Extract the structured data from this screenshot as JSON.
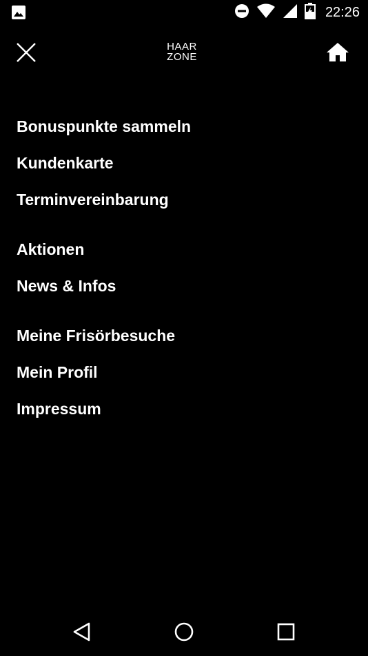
{
  "status_bar": {
    "time": "22:26",
    "icons": [
      "image-notification-icon",
      "do-not-disturb-icon",
      "wifi-icon",
      "cellular-signal-icon",
      "battery-icon"
    ]
  },
  "header": {
    "close_icon": "close-icon",
    "logo_line1": "HAAR",
    "logo_line2": "ZONE",
    "home_icon": "home-icon"
  },
  "menu": {
    "items": [
      {
        "label": "Bonuspunkte sammeln"
      },
      {
        "label": "Kundenkarte"
      },
      {
        "label": "Terminvereinbarung"
      },
      {
        "label": "Aktionen"
      },
      {
        "label": "News & Infos"
      },
      {
        "label": "Meine Frisörbesuche"
      },
      {
        "label": "Mein Profil"
      },
      {
        "label": "Impressum"
      }
    ]
  },
  "nav_bar": {
    "icons": [
      "back-icon",
      "home-circle-icon",
      "recents-icon"
    ]
  },
  "colors": {
    "background": "#000000",
    "foreground": "#ffffff"
  }
}
